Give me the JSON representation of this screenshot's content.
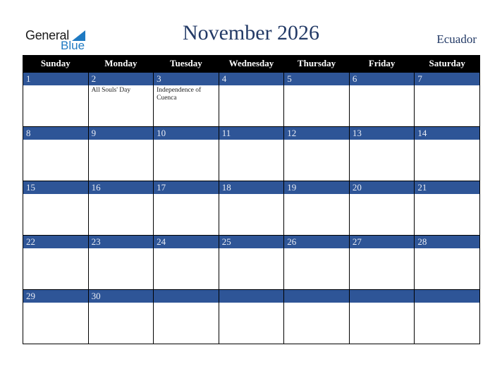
{
  "logo": {
    "line1": "General",
    "line2": "Blue"
  },
  "header": {
    "title": "November 2026",
    "country": "Ecuador"
  },
  "colors": {
    "header_bg": "#000000",
    "daybar_bg": "#2e5597",
    "title": "#233a66",
    "logo_blue": "#1f7ac2"
  },
  "weekdays": [
    "Sunday",
    "Monday",
    "Tuesday",
    "Wednesday",
    "Thursday",
    "Friday",
    "Saturday"
  ],
  "weeks": [
    [
      {
        "day": "1",
        "event": ""
      },
      {
        "day": "2",
        "event": "All Souls' Day"
      },
      {
        "day": "3",
        "event": "Independence of Cuenca"
      },
      {
        "day": "4",
        "event": ""
      },
      {
        "day": "5",
        "event": ""
      },
      {
        "day": "6",
        "event": ""
      },
      {
        "day": "7",
        "event": ""
      }
    ],
    [
      {
        "day": "8",
        "event": ""
      },
      {
        "day": "9",
        "event": ""
      },
      {
        "day": "10",
        "event": ""
      },
      {
        "day": "11",
        "event": ""
      },
      {
        "day": "12",
        "event": ""
      },
      {
        "day": "13",
        "event": ""
      },
      {
        "day": "14",
        "event": ""
      }
    ],
    [
      {
        "day": "15",
        "event": ""
      },
      {
        "day": "16",
        "event": ""
      },
      {
        "day": "17",
        "event": ""
      },
      {
        "day": "18",
        "event": ""
      },
      {
        "day": "19",
        "event": ""
      },
      {
        "day": "20",
        "event": ""
      },
      {
        "day": "21",
        "event": ""
      }
    ],
    [
      {
        "day": "22",
        "event": ""
      },
      {
        "day": "23",
        "event": ""
      },
      {
        "day": "24",
        "event": ""
      },
      {
        "day": "25",
        "event": ""
      },
      {
        "day": "26",
        "event": ""
      },
      {
        "day": "27",
        "event": ""
      },
      {
        "day": "28",
        "event": ""
      }
    ],
    [
      {
        "day": "29",
        "event": ""
      },
      {
        "day": "30",
        "event": ""
      },
      {
        "day": "",
        "event": ""
      },
      {
        "day": "",
        "event": ""
      },
      {
        "day": "",
        "event": ""
      },
      {
        "day": "",
        "event": ""
      },
      {
        "day": "",
        "event": ""
      }
    ]
  ]
}
